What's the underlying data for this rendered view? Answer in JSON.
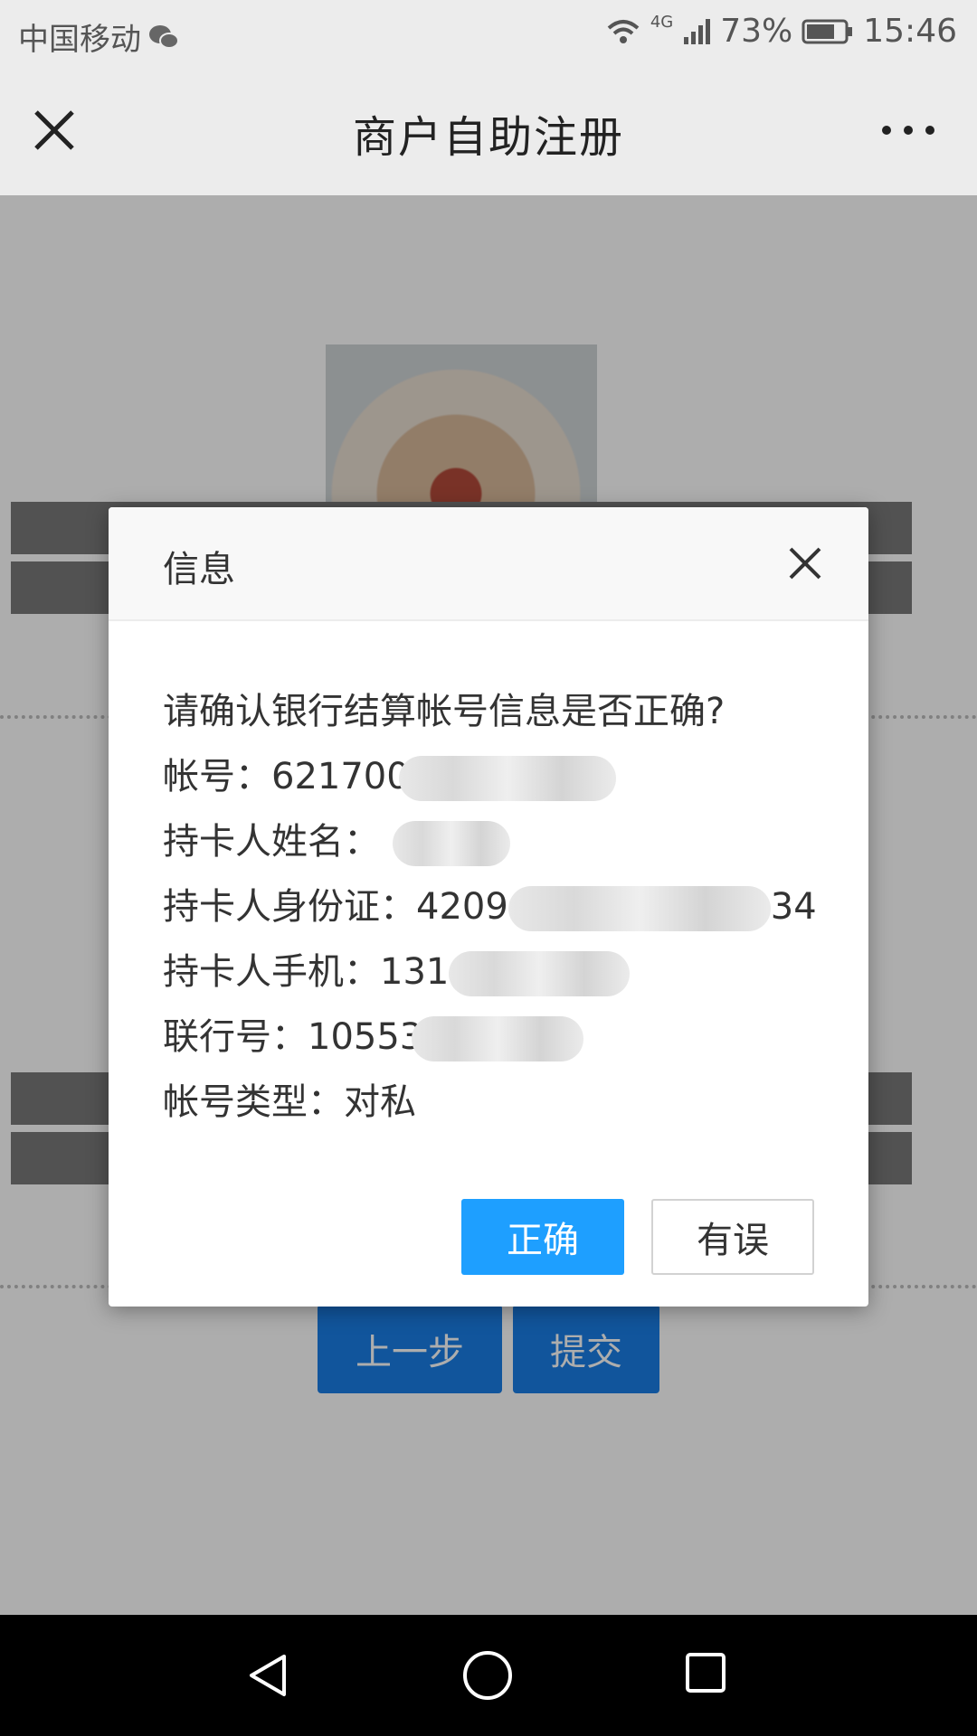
{
  "status_bar": {
    "carrier": "中国移动",
    "network": "4G",
    "battery": "73%",
    "time": "15:46"
  },
  "header": {
    "title": "商户自助注册"
  },
  "page": {
    "prev_label": "上一步",
    "submit_label": "提交"
  },
  "dialog": {
    "title": "信息",
    "prompt": "请确认银行结算帐号信息是否正确?",
    "account_label": "帐号：",
    "account_value": "621700",
    "holder_name_label": "持卡人姓名：",
    "holder_id_label": "持卡人身份证：",
    "holder_id_prefix": "4209",
    "holder_id_suffix": "34",
    "holder_phone_label": "持卡人手机：",
    "holder_phone_prefix": "131",
    "bank_code_label": "联行号：",
    "bank_code_value": "10553",
    "account_type_label": "帐号类型：",
    "account_type_value": "对私",
    "confirm_label": "正确",
    "error_label": "有误"
  },
  "colors": {
    "primary": "#1e9fff",
    "page_button": "#1a7ee6"
  },
  "icons": {
    "close": "close-icon",
    "more": "more-icon",
    "dialog_close": "dialog-close-icon",
    "wechat": "wechat-icon",
    "wifi": "wifi-icon",
    "signal": "signal-icon",
    "battery": "battery-icon",
    "back": "back-triangle-icon",
    "home": "home-circle-icon",
    "recent": "recent-square-icon"
  }
}
